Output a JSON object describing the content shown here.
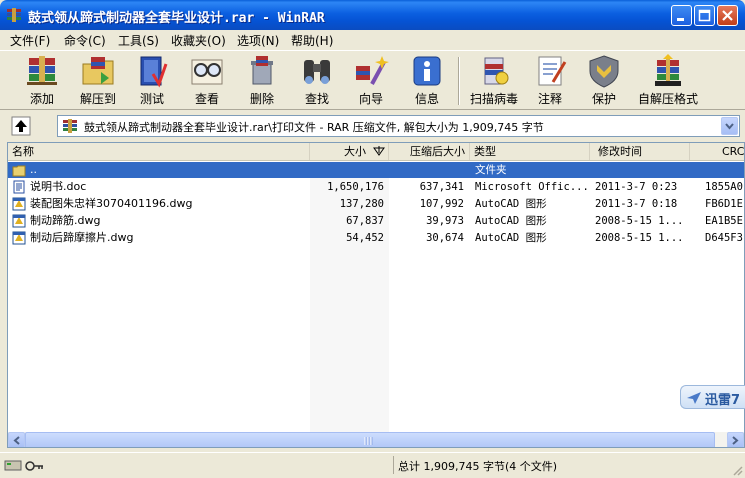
{
  "window": {
    "title": "鼓式领从蹄式制动器全套毕业设计.rar - WinRAR"
  },
  "menu": [
    {
      "label": "文件(F)"
    },
    {
      "label": "命令(C)"
    },
    {
      "label": "工具(S)"
    },
    {
      "label": "收藏夹(O)"
    },
    {
      "label": "选项(N)"
    },
    {
      "label": "帮助(H)"
    }
  ],
  "toolbar": [
    {
      "label": "添加",
      "icon": "books-add-icon"
    },
    {
      "label": "解压到",
      "icon": "folder-extract-icon"
    },
    {
      "label": "测试",
      "icon": "test-book-icon"
    },
    {
      "label": "查看",
      "icon": "glasses-view-icon"
    },
    {
      "label": "删除",
      "icon": "delete-icon"
    },
    {
      "label": "查找",
      "icon": "binoculars-find-icon"
    },
    {
      "label": "向导",
      "icon": "wizard-icon"
    },
    {
      "label": "信息",
      "icon": "info-icon"
    },
    {
      "label": "扫描病毒",
      "icon": "virus-scan-icon"
    },
    {
      "label": "注释",
      "icon": "comment-icon"
    },
    {
      "label": "保护",
      "icon": "shield-protect-icon"
    },
    {
      "label": "自解压格式",
      "icon": "sfx-icon"
    }
  ],
  "address": {
    "path": "鼓式领从蹄式制动器全套毕业设计.rar\\打印文件 - RAR 压缩文件, 解包大小为 1,909,745 字节"
  },
  "columns": [
    "名称",
    "大小",
    "压缩后大小",
    "类型",
    "修改时间",
    "CRC"
  ],
  "files": [
    {
      "name": "..",
      "size": "",
      "packed": "",
      "type": "文件夹",
      "modified": "",
      "crc": "",
      "icon": "folder-up-icon",
      "selected": true
    },
    {
      "name": "说明书.doc",
      "size": "1,650,176",
      "packed": "637,341",
      "type": "Microsoft Offic...",
      "modified": "2011-3-7 0:23",
      "crc": "1855A0",
      "icon": "word-doc-icon",
      "selected": false
    },
    {
      "name": "装配图朱忠祥3070401196.dwg",
      "size": "137,280",
      "packed": "107,992",
      "type": "AutoCAD 图形",
      "modified": "2011-3-7 0:18",
      "crc": "FB6D1E",
      "icon": "dwg-file-icon",
      "selected": false
    },
    {
      "name": "制动蹄筋.dwg",
      "size": "67,837",
      "packed": "39,973",
      "type": "AutoCAD 图形",
      "modified": "2008-5-15 1...",
      "crc": "EA1B5E",
      "icon": "dwg-file-icon",
      "selected": false
    },
    {
      "name": "制动后蹄摩擦片.dwg",
      "size": "54,452",
      "packed": "30,674",
      "type": "AutoCAD 图形",
      "modified": "2008-5-15 1...",
      "crc": "D645F3",
      "icon": "dwg-file-icon",
      "selected": false
    }
  ],
  "badge": {
    "label": "迅雷7"
  },
  "status": {
    "text": "总计 1,909,745 字节(4 个文件)"
  },
  "colors": {
    "title_bar": "#0553d4",
    "selection": "#316ac5",
    "window_bg": "#ECE9D8"
  }
}
